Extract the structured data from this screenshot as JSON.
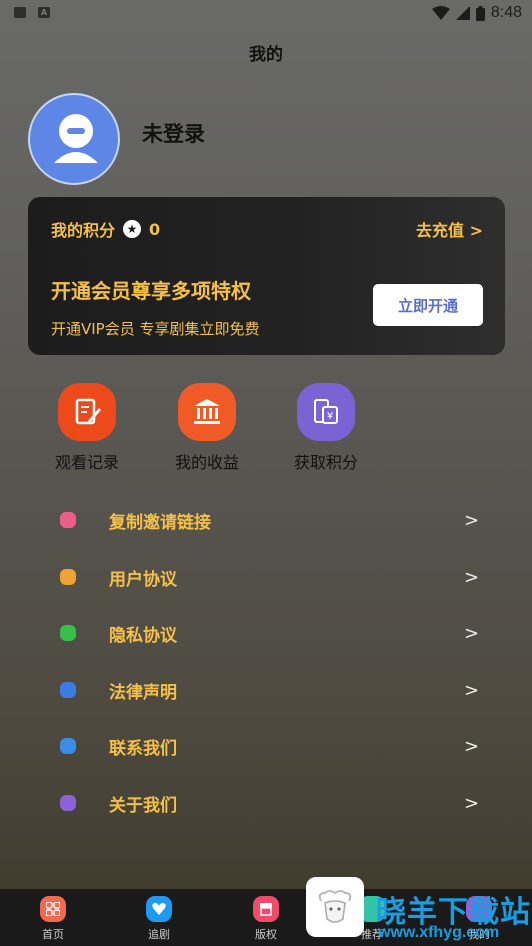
{
  "status_bar": {
    "time": "8:48",
    "left_icon_2": "A"
  },
  "page": {
    "title": "我的"
  },
  "user": {
    "name": "未登录"
  },
  "vip_card": {
    "points_label": "我的积分",
    "points_value": "0",
    "recharge_label": "去充值 >",
    "title": "开通会员尊享多项特权",
    "subtitle": "开通VIP会员 专享剧集立即免费",
    "button_label": "立即开通"
  },
  "quick_actions": [
    {
      "label": "观看记录",
      "icon": "edit-icon",
      "color": "#ec4a1a"
    },
    {
      "label": "我的收益",
      "icon": "bank-icon",
      "color": "#ef5a26"
    },
    {
      "label": "获取积分",
      "icon": "coin-exchange-icon",
      "color": "#7b63d3"
    }
  ],
  "menu": [
    {
      "label": "复制邀请链接",
      "icon": "tag-icon",
      "color": "#ee5e8a"
    },
    {
      "label": "用户协议",
      "icon": "document-icon",
      "color": "#f1a235"
    },
    {
      "label": "隐私协议",
      "icon": "shield-icon",
      "color": "#35c049"
    },
    {
      "label": "法律声明",
      "icon": "flag-icon",
      "color": "#3b7be4"
    },
    {
      "label": "联系我们",
      "icon": "headset-icon",
      "color": "#3a8ce8"
    },
    {
      "label": "关于我们",
      "icon": "info-icon",
      "color": "#8a63d8"
    }
  ],
  "chevron": ">",
  "tabbar": [
    {
      "label": "首页",
      "icon": "grid-icon",
      "color": "#f06a4f"
    },
    {
      "label": "追剧",
      "icon": "heart-icon",
      "color": "#1e9bf0"
    },
    {
      "label": "版权",
      "icon": "store-icon",
      "color": "#ef4c6c"
    },
    {
      "label": "推荐",
      "icon": "tag-icon",
      "color": "#33c3a8"
    },
    {
      "label": "我的",
      "icon": "user-icon",
      "color": "#8b65d8"
    }
  ],
  "watermark": {
    "brand": "晓羊下载站",
    "url": "www.xfhyg.com"
  }
}
